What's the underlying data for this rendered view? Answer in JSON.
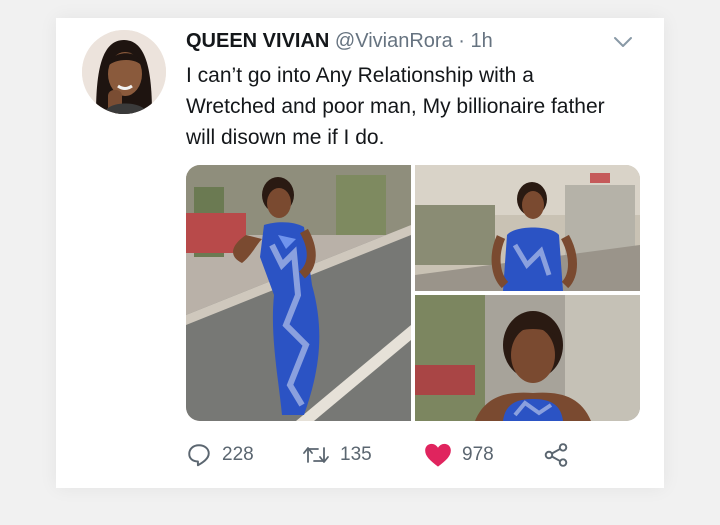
{
  "tweet": {
    "display_name": "QUEEN VIVIAN",
    "handle": "@VivianRora",
    "separator": "·",
    "time": "1h",
    "text": "I can’t go into Any Relationship with a Wretched and poor man,  My billionaire father will disown me if I do.",
    "media_count": 3
  },
  "actions": {
    "reply_count": "228",
    "retweet_count": "135",
    "like_count": "978",
    "liked": true
  },
  "colors": {
    "like": "#e0245e",
    "dress_blue": "#2b53c4",
    "secondary_text": "#667380"
  },
  "icons": {
    "reply": "reply-icon",
    "retweet": "retweet-icon",
    "like": "heart-icon",
    "share": "share-icon",
    "menu": "chevron-down-icon"
  }
}
